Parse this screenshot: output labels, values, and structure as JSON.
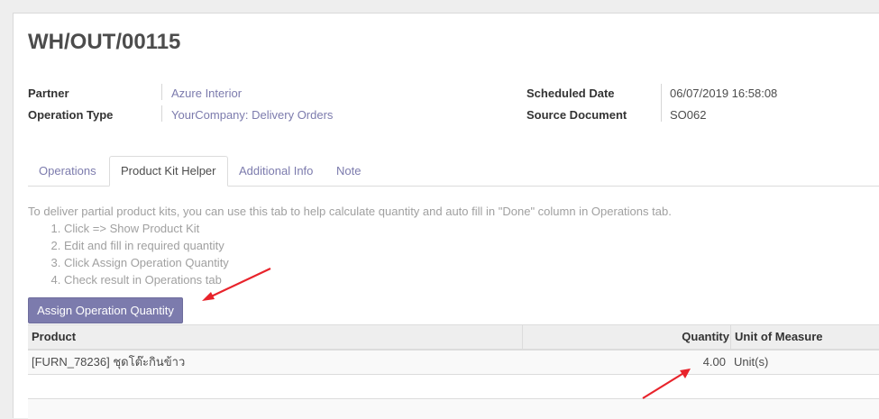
{
  "record": {
    "title": "WH/OUT/00115",
    "partner_label": "Partner",
    "partner_value": "Azure Interior",
    "operation_type_label": "Operation Type",
    "operation_type_value": "YourCompany: Delivery Orders",
    "scheduled_date_label": "Scheduled Date",
    "scheduled_date_value": "06/07/2019 16:58:08",
    "source_document_label": "Source Document",
    "source_document_value": "SO062"
  },
  "tabs": [
    {
      "label": "Operations",
      "active": false
    },
    {
      "label": "Product Kit Helper",
      "active": true
    },
    {
      "label": "Additional Info",
      "active": false
    },
    {
      "label": "Note",
      "active": false
    }
  ],
  "helper": {
    "intro": "To deliver partial product kits, you can use this tab to help calculate quantity and auto fill in \"Done\" column in Operations tab.",
    "steps": [
      "Click => Show Product Kit",
      "Edit and fill in required quantity",
      "Click Assign Operation Quantity",
      "Check result in Operations tab"
    ],
    "button_label": "Assign Operation Quantity"
  },
  "table": {
    "columns": [
      "Product",
      "Quantity",
      "Unit of Measure"
    ],
    "rows": [
      {
        "product": "[FURN_78236] ชุดโต๊ะกินข้าว",
        "quantity": "4.00",
        "uom": "Unit(s)"
      }
    ]
  },
  "colors": {
    "accent": "#7c7bad",
    "annotation": "#e8232b"
  },
  "icons": [
    "arrow-annotation-icon"
  ]
}
